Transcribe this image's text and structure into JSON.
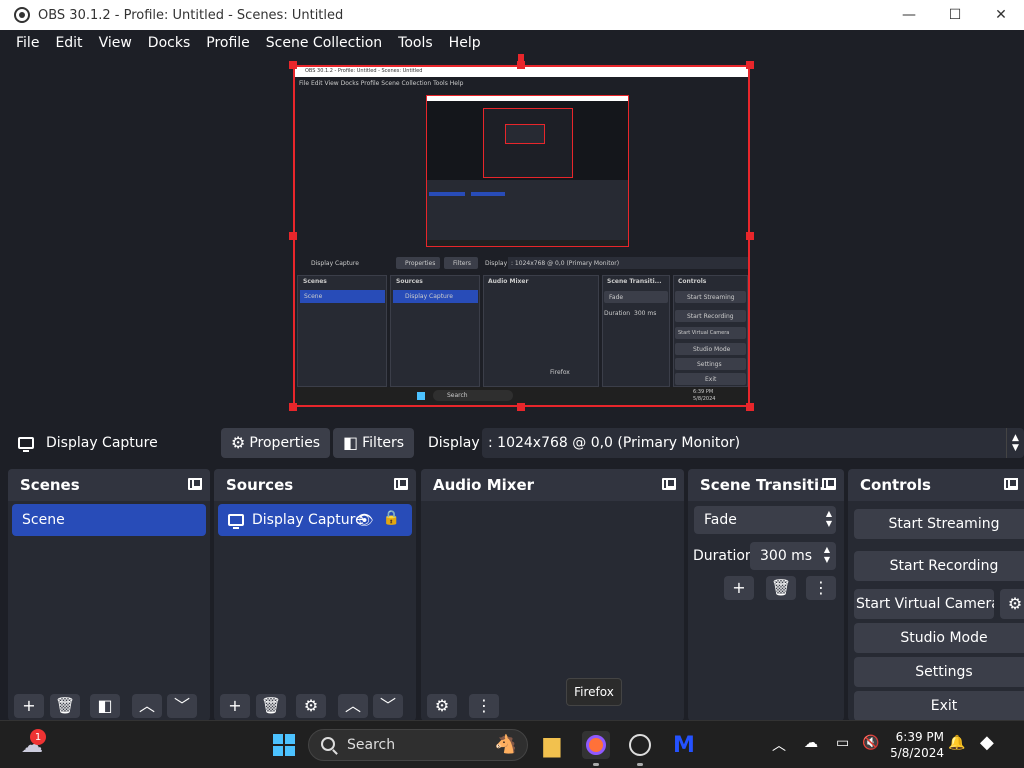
{
  "window": {
    "title": "OBS 30.1.2 - Profile: Untitled - Scenes: Untitled",
    "minimize": "—",
    "maximize": "☐",
    "close": "✕"
  },
  "menu": [
    "File",
    "Edit",
    "View",
    "Docks",
    "Profile",
    "Scene Collection",
    "Tools",
    "Help"
  ],
  "mini_preview": {
    "title": "OBS 30.1.2 - Profile: Untitled - Scenes: Untitled",
    "menu": "File   Edit   View   Docks   Profile   Scene Collection   Tools   Help",
    "source": "Display Capture",
    "properties": "Properties",
    "filters": "Filters",
    "display": "Display",
    "display_value": ": 1024x768 @ 0,0 (Primary Monitor)",
    "scenes": "Scenes",
    "sources": "Sources",
    "mixer": "Audio Mixer",
    "transitions": "Scene Transiti...",
    "controls": "Controls",
    "scene": "Scene",
    "display_capture": "Display Capture",
    "fade": "Fade",
    "duration": "Duration",
    "duration_value": "300 ms",
    "start_streaming": "Start Streaming",
    "start_recording": "Start Recording",
    "start_virtual": "Start Virtual Camera",
    "studio_mode": "Studio Mode",
    "settings": "Settings",
    "exit": "Exit",
    "firefox": "Firefox",
    "search": "Search",
    "time": "6:39 PM",
    "date": "5/8/2024"
  },
  "context": {
    "source_name": "Display Capture",
    "properties": "Properties",
    "filters": "Filters",
    "display_label": "Display",
    "display_value": ": 1024x768 @ 0,0 (Primary Monitor)"
  },
  "scenes": {
    "title": "Scenes",
    "items": [
      "Scene"
    ]
  },
  "sources": {
    "title": "Sources",
    "items": [
      "Display Capture"
    ]
  },
  "audio_mixer": {
    "title": "Audio Mixer"
  },
  "transitions": {
    "title": "Scene Transiti...",
    "selected": "Fade",
    "duration_label": "Duration",
    "duration_value": "300 ms"
  },
  "controls": {
    "title": "Controls",
    "start_streaming": "Start Streaming",
    "start_recording": "Start Recording",
    "start_virtual_camera": "Start Virtual Camera",
    "studio_mode": "Studio Mode",
    "settings": "Settings",
    "exit": "Exit"
  },
  "tooltip": "Firefox",
  "taskbar": {
    "search_placeholder": "Search",
    "time": "6:39 PM",
    "date": "5/8/2024",
    "weather_badge": "1"
  },
  "colors": {
    "accent": "#284cb8",
    "selection_border": "#e8262b",
    "background": "#1d1f26",
    "panel": "#272a33"
  }
}
